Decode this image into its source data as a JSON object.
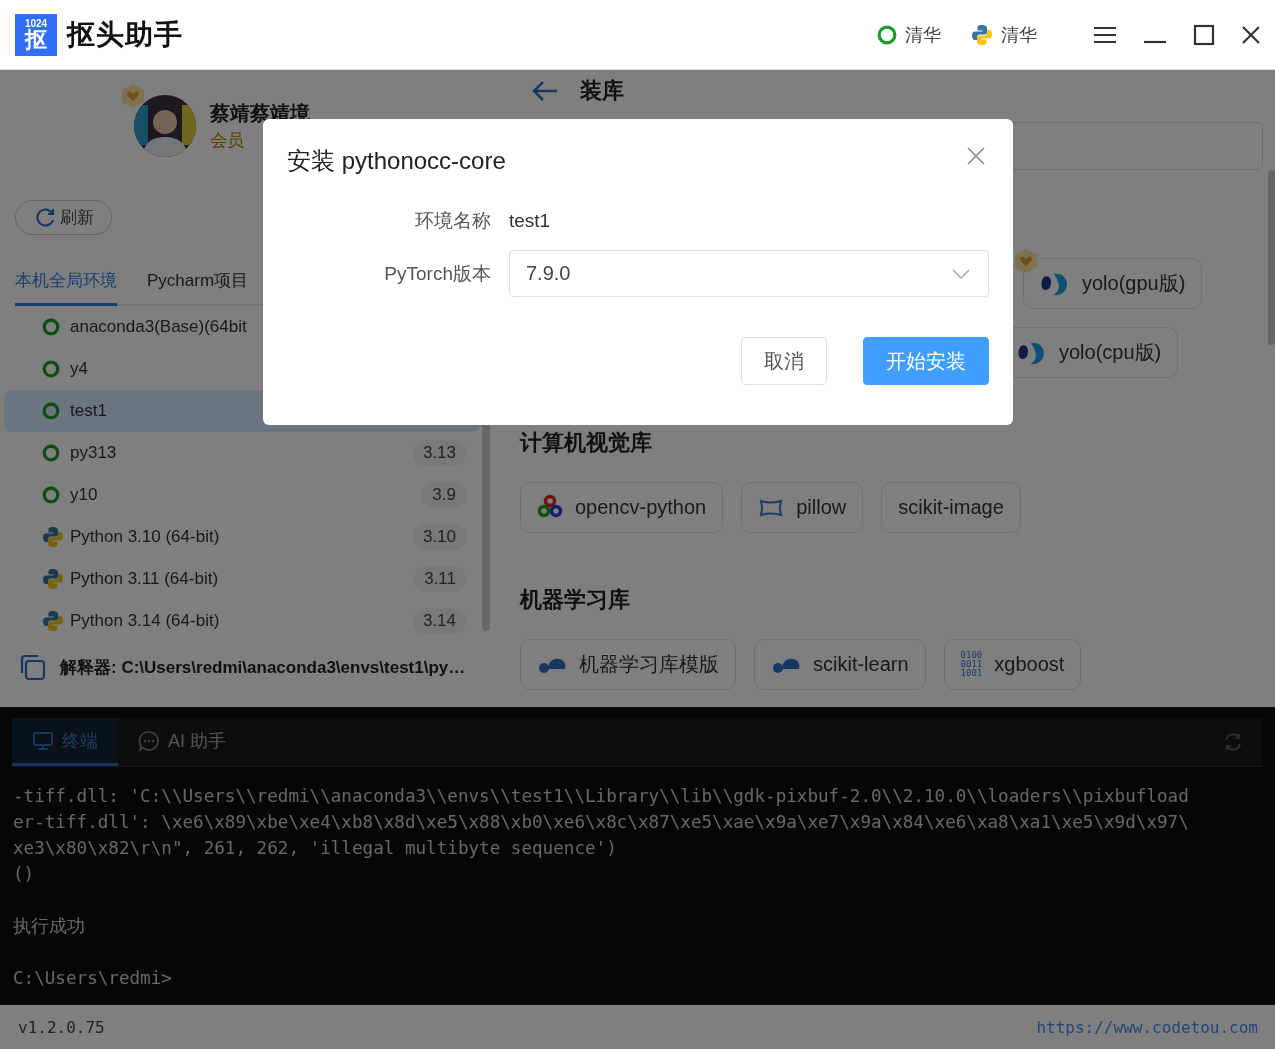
{
  "app": {
    "logo_lines": [
      "1024",
      "抠"
    ],
    "name": "抠头助手"
  },
  "title_bar": {
    "mirrors": [
      {
        "kind": "conda",
        "label": "清华"
      },
      {
        "kind": "python",
        "label": "清华"
      }
    ]
  },
  "user": {
    "name": "蔡靖蔡靖境",
    "role": "会员",
    "vip": true
  },
  "refresh_button": "刷新",
  "env_tabs": [
    {
      "label": "本机全局环境",
      "selected": true
    },
    {
      "label": "Pycharm项目",
      "selected": false
    }
  ],
  "environments": [
    {
      "kind": "conda",
      "name": "anaconda3(Base)(64bit",
      "selected": false
    },
    {
      "kind": "conda",
      "name": "y4",
      "selected": false
    },
    {
      "kind": "conda",
      "name": "test1",
      "selected": true
    },
    {
      "kind": "conda",
      "name": "py313",
      "version": "3.13",
      "selected": false
    },
    {
      "kind": "conda",
      "name": "y10",
      "version": "3.9",
      "selected": false
    },
    {
      "kind": "python",
      "name": "Python 3.10 (64-bit)",
      "version": "3.10",
      "selected": false
    },
    {
      "kind": "python",
      "name": "Python 3.11 (64-bit)",
      "version": "3.11",
      "selected": false
    },
    {
      "kind": "python",
      "name": "Python 3.14 (64-bit)",
      "version": "3.14",
      "selected": false
    }
  ],
  "interpreter": "解释器: C:\\Users\\redmi\\anaconda3\\envs\\test1\\py…",
  "page_title": "装库",
  "featured": [
    {
      "kind": "yolo",
      "label": "yolo(gpu版)",
      "vip": true
    },
    {
      "kind": "yolo",
      "label": "yolo(cpu版)",
      "vip": false
    }
  ],
  "sections": [
    {
      "title": "计算机视觉库",
      "packages": [
        {
          "kind": "opencv",
          "label": "opencv-python"
        },
        {
          "kind": "pillow",
          "label": "pillow"
        },
        {
          "kind": "plain",
          "label": "scikit-image"
        }
      ]
    },
    {
      "title": "机器学习库",
      "packages": [
        {
          "kind": "sklearn",
          "label": "机器学习库模版"
        },
        {
          "kind": "sklearn",
          "label": "scikit-learn"
        },
        {
          "kind": "binary",
          "icon_text": [
            "0100",
            "0011",
            "1001"
          ],
          "label": "xgboost"
        }
      ]
    }
  ],
  "terminal": {
    "tabs": [
      {
        "kind": "terminal",
        "label": "终端",
        "selected": true
      },
      {
        "kind": "chat",
        "label": "AI 助手",
        "selected": false
      }
    ],
    "blocks": [
      [
        "-tiff.dll: 'C:\\\\Users\\\\redmi\\\\anaconda3\\\\envs\\\\test1\\\\Library\\\\lib\\\\gdk-pixbuf-2.0\\\\2.10.0\\\\loaders\\\\pixbufload",
        "er-tiff.dll': \\xe6\\x89\\xbe\\xe4\\xb8\\x8d\\xe5\\x88\\xb0\\xe6\\x8c\\x87\\xe5\\xae\\x9a\\xe7\\x9a\\x84\\xe6\\xa8\\xa1\\xe5\\x9d\\x97\\",
        "xe3\\x80\\x82\\r\\n\", 261, 262, 'illegal multibyte sequence')",
        "()"
      ],
      [
        "执行成功"
      ],
      [
        "C:\\Users\\redmi>"
      ]
    ]
  },
  "status_bar": {
    "version": "v1.2.0.75",
    "link": "https://www.codetou.com"
  },
  "dialog": {
    "title": "安装 pythonocc-core",
    "fields": [
      {
        "kind": "text",
        "label": "环境名称",
        "value": "test1"
      },
      {
        "kind": "select",
        "label": "PyTorch版本",
        "value": "7.9.0"
      }
    ],
    "buttons": [
      {
        "kind": "secondary",
        "label": "取消"
      },
      {
        "kind": "primary",
        "label": "开始安装"
      }
    ]
  }
}
